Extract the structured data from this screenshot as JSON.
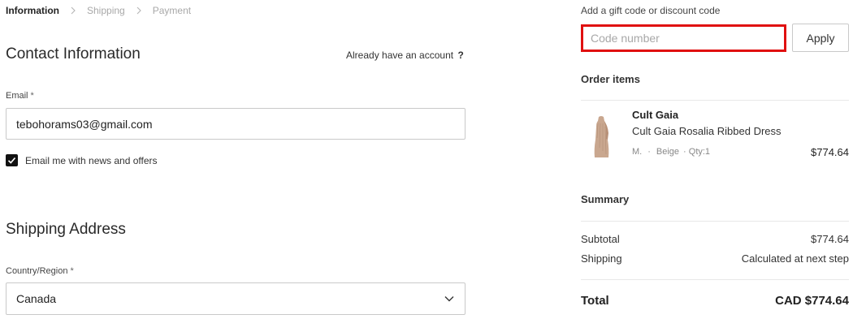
{
  "breadcrumb": {
    "items": [
      {
        "label": "Information"
      },
      {
        "label": "Shipping"
      },
      {
        "label": "Payment"
      }
    ]
  },
  "contact": {
    "heading": "Contact Information",
    "account_prompt": "Already have an account",
    "account_link": "?",
    "email_label": "Email",
    "required_mark": "*",
    "email_value": "tebohorams03@gmail.com",
    "newsletter_label": "Email me with news and offers",
    "newsletter_checked": true
  },
  "shipping": {
    "heading": "Shipping Address",
    "country_label": "Country/Region",
    "required_mark": "*",
    "country_value": "Canada"
  },
  "discount": {
    "label": "Add a gift code or discount code",
    "placeholder": "Code number",
    "apply_label": "Apply"
  },
  "order": {
    "heading": "Order items",
    "items": [
      {
        "brand": "Cult Gaia",
        "name": "Cult Gaia Rosalia Ribbed Dress",
        "size": "M.",
        "separator": "·",
        "color": "Beige",
        "qty": "· Qty:1",
        "price": "$774.64"
      }
    ]
  },
  "summary": {
    "heading": "Summary",
    "subtotal_label": "Subtotal",
    "subtotal_value": "$774.64",
    "shipping_label": "Shipping",
    "shipping_value": "Calculated at next step",
    "total_label": "Total",
    "total_value": "CAD $774.64"
  },
  "colors": {
    "highlight_border": "#e01010",
    "text_primary": "#222222",
    "text_muted": "#a8a8a8"
  }
}
